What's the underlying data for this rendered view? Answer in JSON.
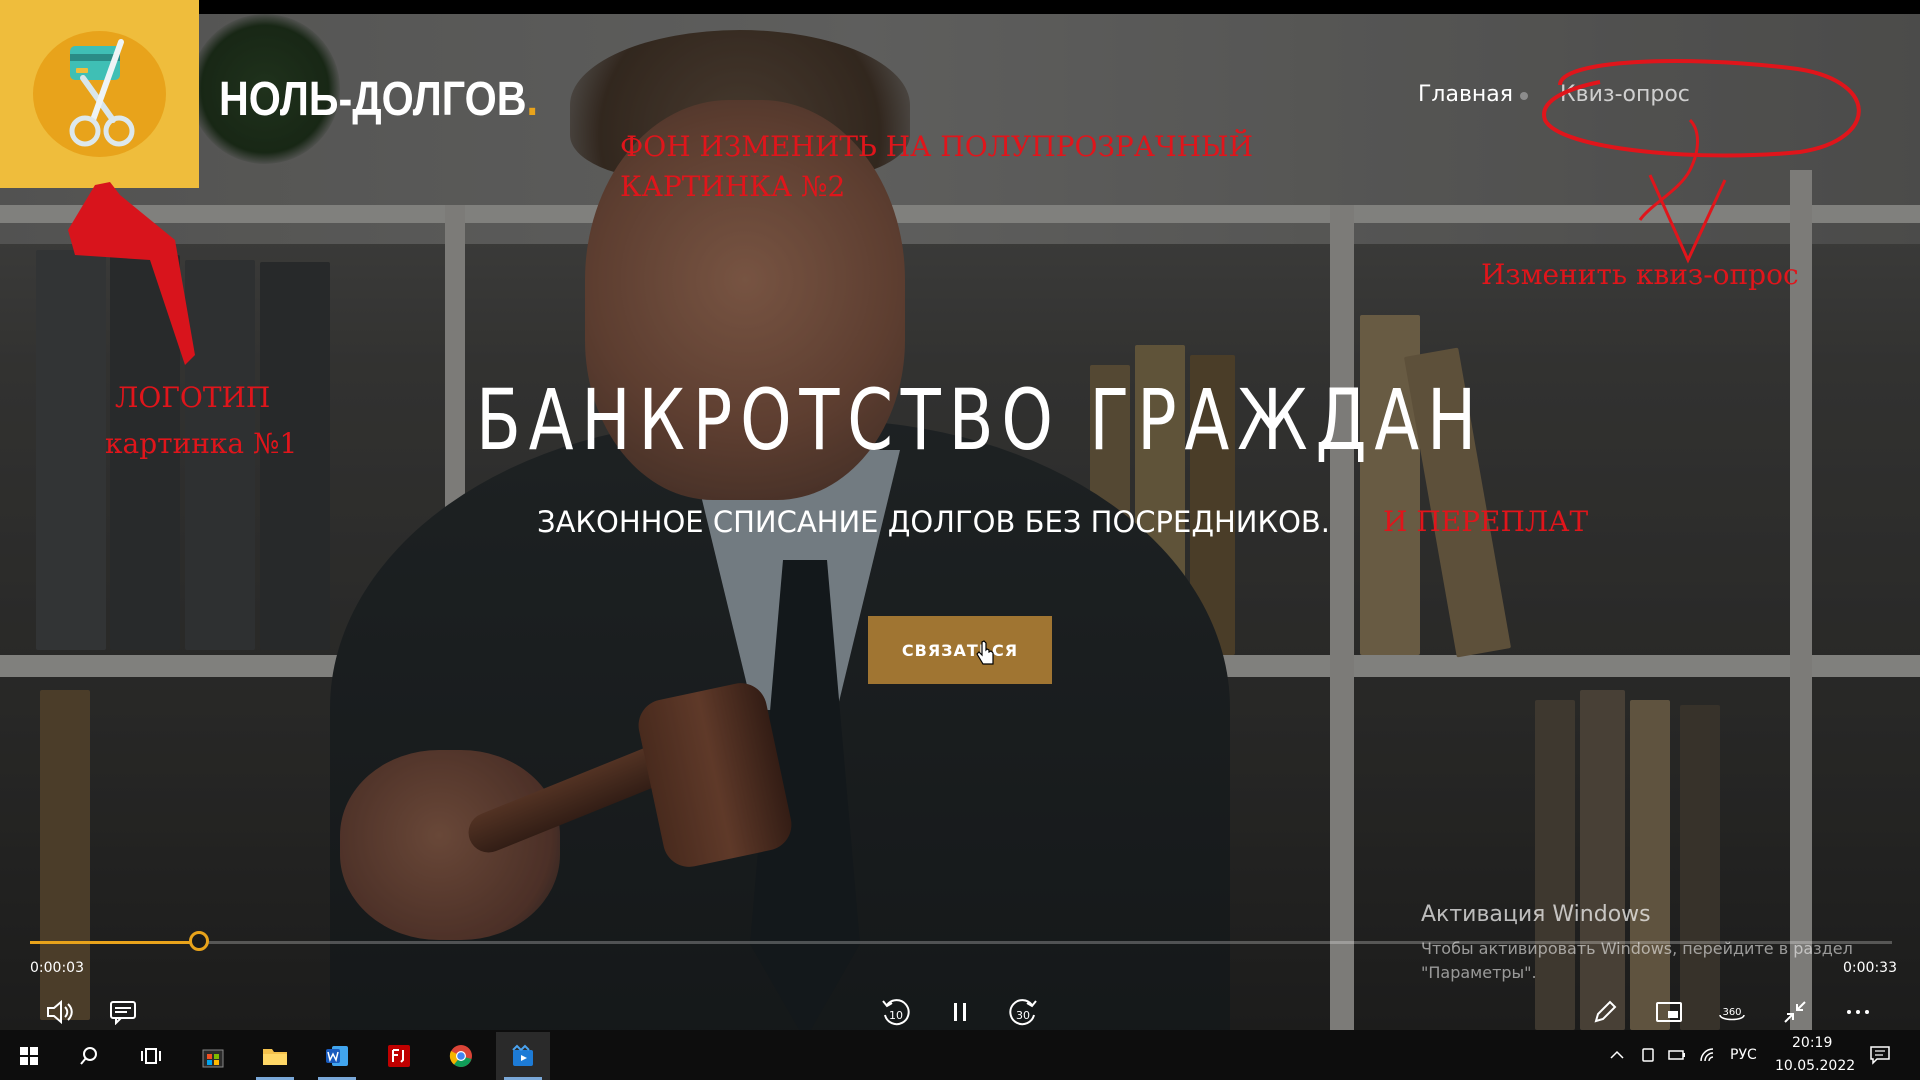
{
  "brand": {
    "name": "НОЛЬ-ДОЛГОВ",
    "dot": "."
  },
  "nav": {
    "items": [
      {
        "label": "Главная"
      },
      {
        "label": "Квиз-опрос"
      }
    ]
  },
  "hero": {
    "title": "БАНКРОТСТВО ГРАЖДАН",
    "subtitle": "ЗАКОННОЕ СПИСАНИЕ ДОЛГОВ БЕЗ ПОСРЕДНИКОВ.",
    "cta_label": "СВЯЗАТЬСЯ"
  },
  "annotations": {
    "background_note_line1": "ФОН ИЗМЕНИТЬ НА ПОЛУПРОЗРАЧНЫЙ",
    "background_note_line2": "КАРТИНКА №2",
    "quiz_note": "Изменить квиз-опрос",
    "logo_note_line1": "ЛОГОТИП",
    "logo_note_line2": "картинка №1",
    "subtitle_addition": "И ПЕРЕПЛАТ",
    "color": "#e0151b"
  },
  "windows_activation": {
    "title": "Активация Windows",
    "line1": "Чтобы активировать Windows, перейдите в раздел",
    "line2": "\"Параметры\"."
  },
  "player": {
    "current_time": "0:00:03",
    "total_time": "0:00:33",
    "progress_fraction": 0.091,
    "rewind_label": "10",
    "forward_label": "30",
    "view_label": "360"
  },
  "taskbar": {
    "language": "РУС",
    "time": "20:19",
    "date": "10.05.2022"
  },
  "colors": {
    "logo_bg": "#efbd3c",
    "logo_circle": "#e8a31b",
    "cta_bg": "#a07532",
    "progress": "#e8a31b"
  }
}
